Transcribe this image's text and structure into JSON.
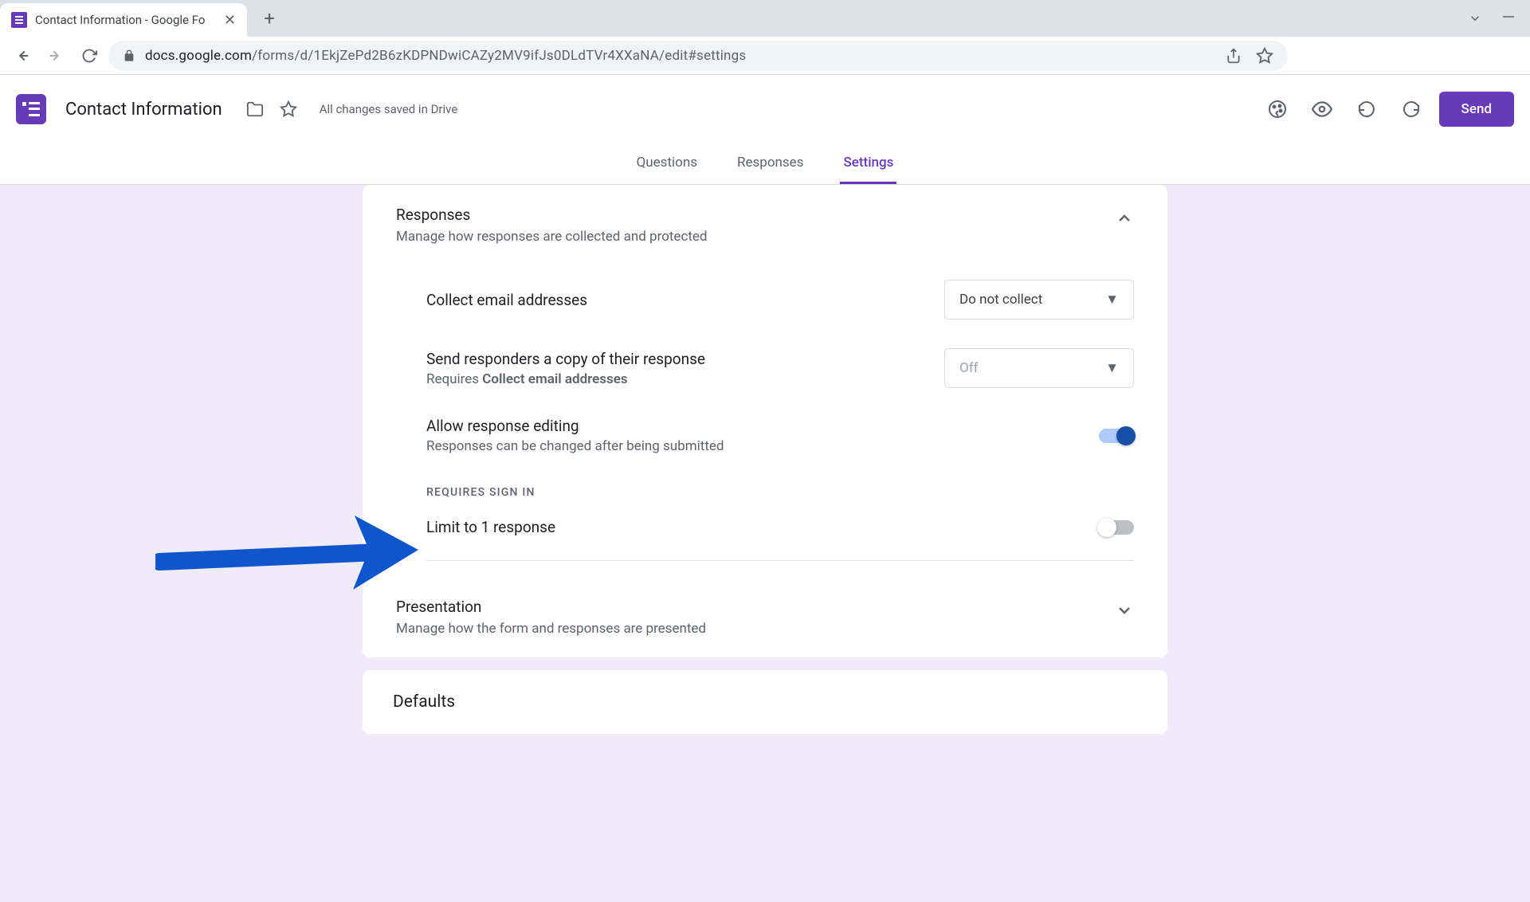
{
  "browser": {
    "tab_title": "Contact Information - Google Fo",
    "url_domain": "docs.google.com",
    "url_path": "/forms/d/1EkjZePd2B6zKDPNDwiCAZy2MV9ifJs0DLdTVr4XXaNA/edit#settings"
  },
  "header": {
    "doc_title": "Contact Information",
    "save_status": "All changes saved in Drive",
    "send_label": "Send"
  },
  "tabs": {
    "questions": "Questions",
    "responses": "Responses",
    "settings": "Settings"
  },
  "settings": {
    "responses_section": {
      "title": "Responses",
      "sub": "Manage how responses are collected and protected",
      "collect_email_label": "Collect email addresses",
      "collect_email_value": "Do not collect",
      "send_copy_label": "Send responders a copy of their response",
      "send_copy_req_prefix": "Requires ",
      "send_copy_req_strong": "Collect email addresses",
      "send_copy_value": "Off",
      "allow_edit_label": "Allow response editing",
      "allow_edit_sub": "Responses can be changed after being submitted",
      "requires_signin_heading": "REQUIRES SIGN IN",
      "limit_label": "Limit to 1 response"
    },
    "presentation_section": {
      "title": "Presentation",
      "sub": "Manage how the form and responses are presented"
    },
    "defaults_section": {
      "title": "Defaults"
    }
  }
}
